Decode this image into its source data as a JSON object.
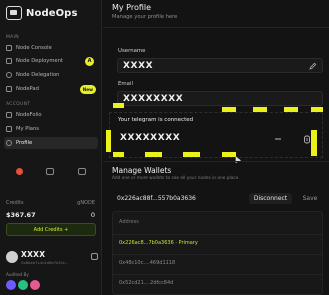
{
  "brand": {
    "name": "NodeOps"
  },
  "sidebar": {
    "main_label": "MAIN",
    "main_items": [
      {
        "label": "Node Console"
      },
      {
        "label": "Node Deployment",
        "badge": "A"
      },
      {
        "label": "Node Delegation"
      },
      {
        "label": "NodePad",
        "badge": "New"
      }
    ],
    "account_label": "ACCOUNT",
    "account_items": [
      {
        "label": "NodeFolio"
      },
      {
        "label": "My Plans"
      },
      {
        "label": "Profile",
        "active": true
      }
    ],
    "credits_label": "Credits",
    "credits_value": "$367.67",
    "gnode_label": "gNODE",
    "gnode_value": "0",
    "add_credits": "Add Credits +",
    "user": {
      "name": "XXXX",
      "sub": "0x8bee7c4c4d6e7bf1e..."
    },
    "audited_by": "Audited By",
    "audit_colors": [
      "#6a5cff",
      "#26c281",
      "#e55b8f"
    ]
  },
  "profile": {
    "title": "My Profile",
    "subtitle": "Manage your profile here",
    "username_label": "Username",
    "username_value": "XXXX",
    "email_label": "Email",
    "email_value": "XXXXXXXX",
    "telegram_status": "Your telegram is connected",
    "telegram_value": "XXXXXXXX"
  },
  "wallets": {
    "title": "Manage Wallets",
    "subtitle": "Add one or more wallets to see all your nodes in one place.",
    "current_address": "0x226ac88f...557b0a3636",
    "disconnect": "Disconnect",
    "save": "Save",
    "table_header": "Address",
    "rows": [
      {
        "address": "0x226ac8...7b0a3636 · Primary",
        "primary": true
      },
      {
        "address": "0x48c10c....469d1118",
        "primary": false
      },
      {
        "address": "0x52cd21....2dfcc84d",
        "primary": false
      }
    ]
  },
  "highlight_color": "#eaf21a"
}
